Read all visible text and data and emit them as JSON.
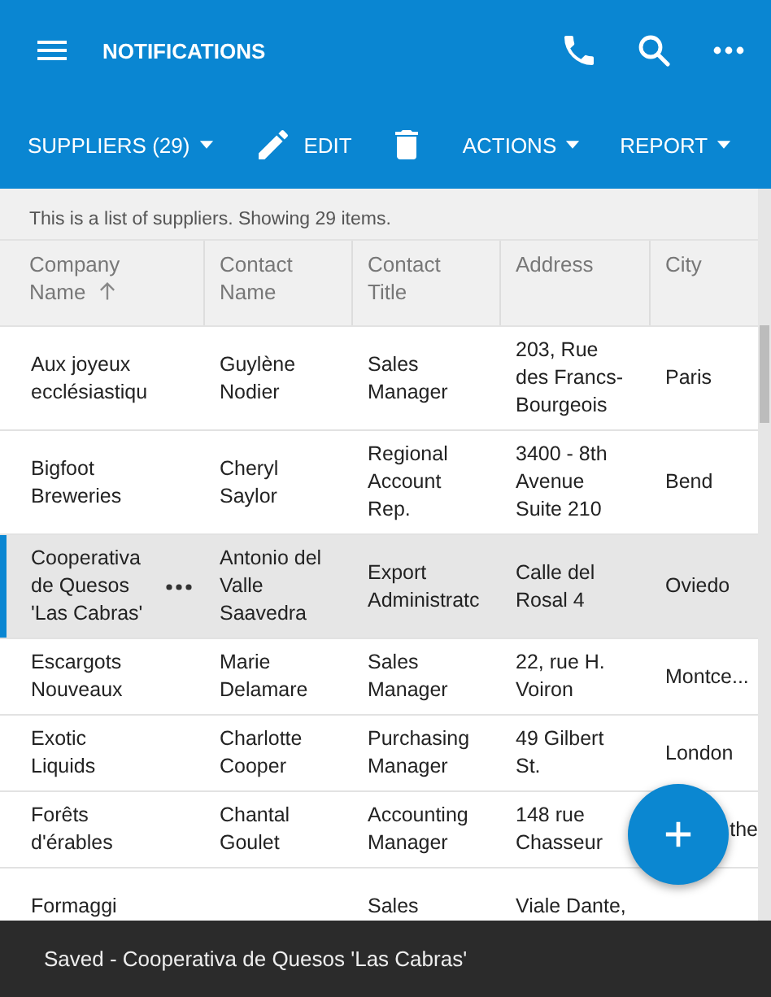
{
  "app_bar": {
    "title": "NOTIFICATIONS"
  },
  "toolbar": [
    {
      "kind": "dropdown",
      "label": "SUPPLIERS (29)"
    },
    {
      "kind": "edit",
      "label": "EDIT"
    },
    {
      "kind": "delete"
    },
    {
      "kind": "dropdown",
      "label": "ACTIONS"
    },
    {
      "kind": "dropdown",
      "label": "REPORT"
    }
  ],
  "description": "This is a list of suppliers. Showing 29 items.",
  "table": {
    "columns": [
      {
        "label": "Company Name",
        "sorted": true
      },
      {
        "label": "Contact Name",
        "sorted": false
      },
      {
        "label": "Contact Title",
        "sorted": false
      },
      {
        "label": "Address",
        "sorted": false
      },
      {
        "label": "City",
        "sorted": false
      }
    ],
    "rows": [
      {
        "selected": false,
        "cells": [
          "Aux joyeux ecclésiastiqu",
          "Guylène Nodier",
          "Sales Manager",
          "203, Rue des Francs-Bourgeois",
          "Paris"
        ]
      },
      {
        "selected": false,
        "cells": [
          "Bigfoot Breweries",
          "Cheryl Saylor",
          "Regional Account Rep.",
          "3400 - 8th Avenue Suite 210",
          "Bend"
        ]
      },
      {
        "selected": true,
        "cells": [
          "Cooperativa de Quesos 'Las Cabras'",
          "Antonio del Valle Saavedra",
          "Export Administratc",
          "Calle del Rosal 4",
          "Oviedo"
        ]
      },
      {
        "selected": false,
        "cells": [
          "Escargots Nouveaux",
          "Marie Delamare",
          "Sales Manager",
          "22, rue H. Voiron",
          "Montce..."
        ]
      },
      {
        "selected": false,
        "cells": [
          "Exotic Liquids",
          "Charlotte Cooper",
          "Purchasing Manager",
          "49 Gilbert St.",
          "London"
        ]
      },
      {
        "selected": false,
        "cells": [
          "Forêts d'érables",
          "Chantal Goulet",
          "Accounting Manager",
          "148 rue Chasseur",
          {
            "text": "the",
            "clipped_left": true
          }
        ]
      },
      {
        "selected": false,
        "cells": [
          "Formaggi",
          "",
          "Sales",
          "Viale Dante,",
          ""
        ]
      }
    ]
  },
  "snackbar": {
    "message": "Saved - Cooperativa de Quesos 'Las Cabras'"
  }
}
